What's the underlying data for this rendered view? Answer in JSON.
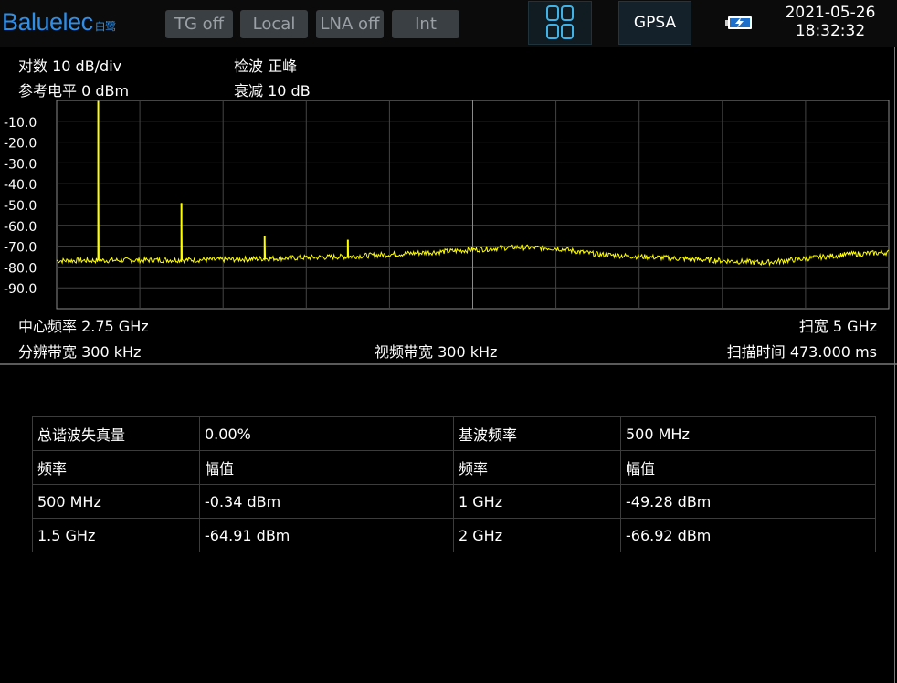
{
  "header": {
    "brand": "Baluelec",
    "brand_sub": "白鹭",
    "status_buttons": [
      "TG off",
      "Local",
      "LNA off",
      "Int"
    ],
    "layout_icon": "grid-2x2-icon",
    "mode": "GPSA",
    "battery_icon": "battery-charging-icon",
    "date": "2021-05-26",
    "time": "18:32:32",
    "colors": {
      "brand": "#2f8fe8",
      "button_bg": "#3a3f44",
      "button_text": "#9aa0a6"
    }
  },
  "info": {
    "scale": "对数 10 dB/div",
    "ref_level": "参考电平 0 dBm",
    "detector": "检波 正峰",
    "attenuation": "衰减 10 dB",
    "center_freq": "中心频率 2.75 GHz",
    "span": "扫宽 5 GHz",
    "rbw": "分辨带宽 300 kHz",
    "vbw": "视频带宽 300 kHz",
    "sweep_time": "扫描时间 473.000 ms"
  },
  "chart_data": {
    "type": "line",
    "y_tick_labels": [
      "-10.0",
      "-20.0",
      "-30.0",
      "-40.0",
      "-50.0",
      "-60.0",
      "-70.0",
      "-80.0",
      "-90.0"
    ],
    "ylim": [
      -100,
      0
    ],
    "xlim": [
      250,
      5250
    ],
    "x_unit": "MHz",
    "y_unit": "dBm",
    "grid": true,
    "trace_color": "#ffff00",
    "noise_floor": [
      [
        250,
        -77
      ],
      [
        1250,
        -76.5
      ],
      [
        2000,
        -75
      ],
      [
        2500,
        -73
      ],
      [
        3000,
        -70.5
      ],
      [
        3250,
        -71
      ],
      [
        3500,
        -74
      ],
      [
        4000,
        -76
      ],
      [
        4500,
        -78
      ],
      [
        5000,
        -74
      ],
      [
        5250,
        -73
      ]
    ],
    "peaks": [
      {
        "x": 500,
        "y": -0.34
      },
      {
        "x": 1000,
        "y": -49.28
      },
      {
        "x": 1500,
        "y": -64.91
      },
      {
        "x": 2000,
        "y": -66.92
      }
    ]
  },
  "harmonics_table": {
    "rows": [
      [
        "总谐波失真量",
        "0.00%",
        "基波频率",
        "500 MHz"
      ],
      [
        "频率",
        "幅值",
        "频率",
        "幅值"
      ],
      [
        "500 MHz",
        "-0.34 dBm",
        "1 GHz",
        "-49.28 dBm"
      ],
      [
        "1.5 GHz",
        "-64.91 dBm",
        "2 GHz",
        "-66.92 dBm"
      ]
    ]
  }
}
